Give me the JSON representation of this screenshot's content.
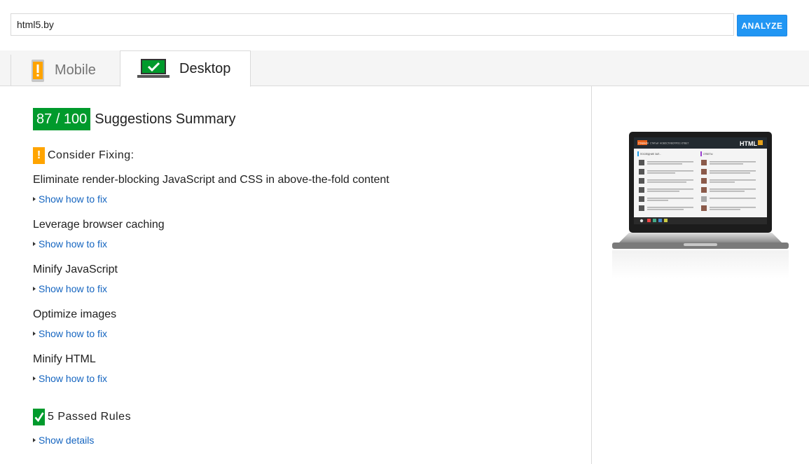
{
  "search": {
    "value": "html5.by",
    "button_label": "ANALYZE"
  },
  "tabs": [
    {
      "label": "Mobile",
      "icon": "mobile-warning-icon",
      "active": false
    },
    {
      "label": "Desktop",
      "icon": "desktop-check-icon",
      "active": true
    }
  ],
  "summary": {
    "score": "87 / 100",
    "title": "Suggestions Summary"
  },
  "consider": {
    "title": "Consider Fixing:",
    "badge": "!",
    "rules": [
      {
        "title": "Eliminate render-blocking JavaScript and CSS in above-the-fold content",
        "link": "Show how to fix"
      },
      {
        "title": "Leverage browser caching",
        "link": "Show how to fix"
      },
      {
        "title": "Minify JavaScript",
        "link": "Show how to fix"
      },
      {
        "title": "Optimize images",
        "link": "Show how to fix"
      },
      {
        "title": "Minify HTML",
        "link": "Show how to fix"
      }
    ]
  },
  "passed": {
    "title": "5 Passed Rules",
    "link": "Show details"
  },
  "preview": {
    "logo": "HTML",
    "nav": [
      "ГЛАВНАЯ",
      "СТАТЬИ",
      "НОВОСТИ",
      "ВОПРОС-ОТВЕТ"
    ],
    "col1": "ПОСЛЕДНИЕ ЗАП...",
    "col2": "ОТВЕТЫ"
  },
  "colors": {
    "accent": "#2196f3",
    "good": "#009a2c",
    "warn": "#ffa400",
    "link": "#1565c0"
  }
}
